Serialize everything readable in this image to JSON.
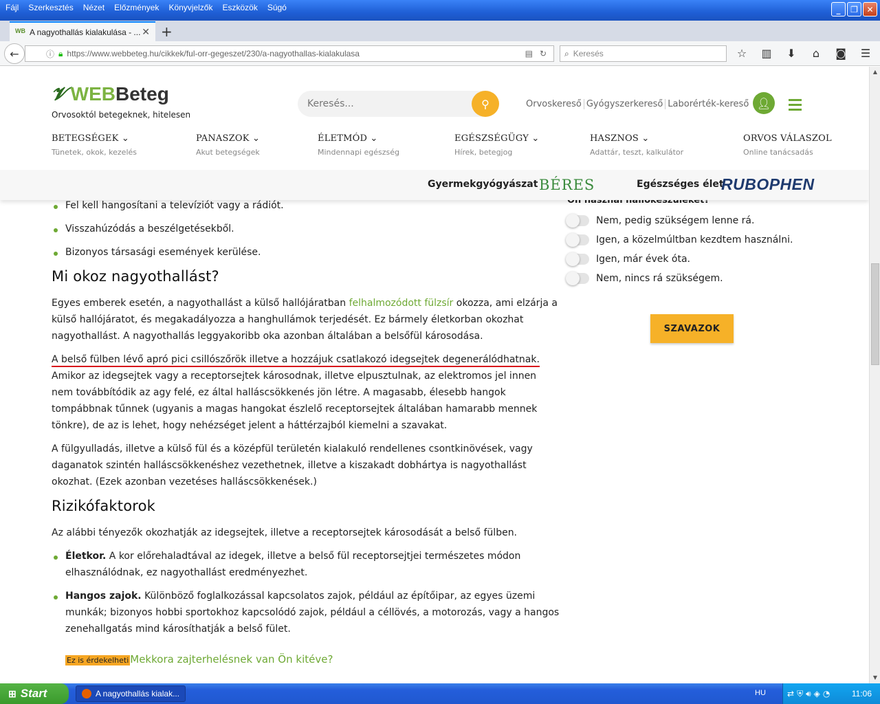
{
  "browser": {
    "menu": [
      "Fájl",
      "Szerkesztés",
      "Nézet",
      "Előzmények",
      "Könyvjelzők",
      "Eszközök",
      "Súgó"
    ],
    "tab_title": "A nagyothallás kialakulása - ...",
    "url_domain": "https://www.webbeteg.hu",
    "url_path": "/cikkek/ful-orr-gegeszet/230/a-nagyothallas-kialakulasa",
    "search_placeholder": "Keresés"
  },
  "site": {
    "logo_web": "WEB",
    "logo_beteg": "Beteg",
    "tagline": "Orvosoktól betegeknek, hitelesen",
    "search_placeholder": "Keresés...",
    "header_links": [
      "Orvoskereső",
      "Gyógyszerkereső",
      "Laborérték-kereső"
    ],
    "nav": [
      {
        "title": "BETEGSÉGEK",
        "sub": "Tünetek, okok, kezelés"
      },
      {
        "title": "PANASZOK",
        "sub": "Akut betegségek"
      },
      {
        "title": "ÉLETMÓD",
        "sub": "Mindennapi egészség"
      },
      {
        "title": "EGÉSZSÉGÜGY",
        "sub": "Hírek, betegjog"
      },
      {
        "title": "HASZNOS",
        "sub": "Adattár, teszt, kalkulátor"
      },
      {
        "title": "ORVOS VÁLASZOL",
        "sub": "Online tanácsadás"
      }
    ],
    "sponsor1_label": "Gyermekgyógyászat",
    "sponsor1_brand": "BÉRES",
    "sponsor2_label": "Egészséges élet",
    "sponsor2_brand": "RUBOPHEN"
  },
  "article": {
    "bullets_top": [
      "Fel kell hangosítani a televíziót vagy a rádiót.",
      "Visszahúzódás a beszélgetésekből.",
      "Bizonyos társasági események kerülése."
    ],
    "h2_cause": "Mi okoz nagyothallást?",
    "p1_before": "Egyes emberek esetén, a nagyothallást a külső hallójáratban ",
    "p1_link": "felhalmozódott fülzsír",
    "p1_after": " okozza, ami elzárja a külső hallójáratot, és megakadályozza a hanghullámok terjedését. Ez bármely életkorban okozhat nagyothallást. A nagyothallás leggyakoribb oka azonban általában a belsőfül károsodása.",
    "p2_underlined": "A belső fülben lévő apró pici csillószőrök illetve a hozzájuk csatlakozó idegsejtek degenerálódhatnak.",
    "p2_rest": " Amikor az idegsejtek vagy a receptorsejtek károsodnak, illetve elpusztulnak, az elektromos jel innen nem továbbítódik az agy felé, ez által halláscsökkenés jön létre. A magasabb, élesebb hangok tompábbnak tűnnek (ugyanis a magas hangokat észlelő receptorsejtek általában hamarabb mennek tönkre), de az is lehet, hogy nehézséget jelent a háttérzajból kiemelni a szavakat.",
    "p3": "A fülgyulladás, illetve a külső fül és a középfül területén kialakuló rendellenes csontkinövések, vagy daganatok szintén halláscsökkenéshez vezethetnek, illetve a kiszakadt dobhártya is nagyothallást okozhat. (Ezek azonban vezetéses halláscsökkenések.)",
    "h2_risk": "Rizikófaktorok",
    "p4": "Az alábbi tényezők okozhatják az idegsejtek, illetve a receptorsejtek károsodását a belső fülben.",
    "risk1_bold": "Életkor.",
    "risk1_text": " A kor előrehaladtával az idegek, illetve a belső fül receptorsejtjei természetes módon elhasználódnak, ez nagyothallást eredményezhet.",
    "risk2_bold": "Hangos zajok.",
    "risk2_text": " Különböző foglalkozással kapcsolatos zajok, például az építőipar, az egyes üzemi munkák; bizonyos hobbi sportokhoz kapcsolódó zajok, például a céllövés, a motorozás, vagy a hangos zenehallgatás mind károsíthatják a belső fület.",
    "tip_badge": "Ez is érdekelheti",
    "tip_link": "Mekkora zajterhelésnek van Ön kitéve?"
  },
  "poll": {
    "question": "Ön használ hallókészüléket?",
    "options": [
      "Nem, pedig szükségem lenne rá.",
      "Igen, a közelmúltban kezdtem használni.",
      "Igen, már évek óta.",
      "Nem, nincs rá szükségem."
    ],
    "vote_label": "SZAVAZOK"
  },
  "taskbar": {
    "start_label": "Start",
    "task_label": "A nagyothallás kialak...",
    "lang": "HU",
    "clock": "11:06"
  },
  "colors": {
    "brand_green": "#6ea934",
    "accent_orange": "#f6b128",
    "underline_red": "#d8141b"
  }
}
